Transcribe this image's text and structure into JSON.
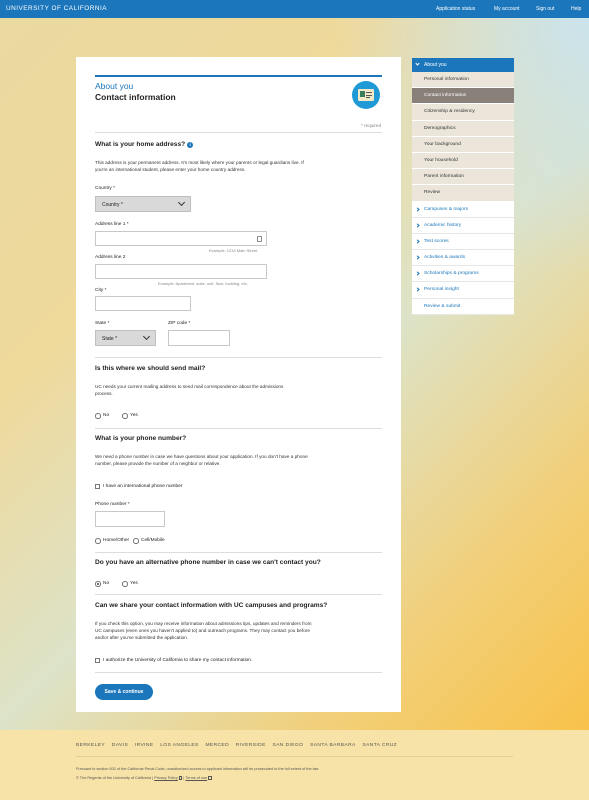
{
  "topbar": {
    "brand": "UNIVERSITY OF CALIFORNIA",
    "nav": [
      "Application status",
      "My account",
      "Sign out",
      "Help"
    ]
  },
  "header": {
    "section": "About you",
    "title": "Contact information",
    "required_note": "* required"
  },
  "home_address": {
    "question": "What is your home address?",
    "description": "This address is your permanent address. It's most likely where your parents or legal guardians live. If you're an international student, please enter your home country address.",
    "country_label": "Country *",
    "country_value": "Country *",
    "address1_label": "Address line 1 *",
    "address1_value": "",
    "address1_example": "Example: 1234 Main Street",
    "address2_label": "Address line 2",
    "address2_value": "",
    "address2_example": "Example: Apartment, suite, unit, floor, building, etc.",
    "city_label": "City *",
    "city_value": "",
    "state_label": "State *",
    "state_value": "State *",
    "zip_label": "ZIP code *",
    "zip_value": ""
  },
  "mailing": {
    "question": "Is this where we should send mail?",
    "description": "UC needs your current mailing address to send mail correspondence about the admissions process.",
    "options": [
      "No",
      "Yes"
    ],
    "selected": null
  },
  "phone": {
    "question": "What is your phone number?",
    "description": "We need a phone number in case we have questions about your application. If you don't have a phone number, please provide the number of a neighbor or relative.",
    "international_label": "I have an international phone number",
    "number_label": "Phone number *",
    "number_value": "",
    "type_options": [
      "Home/Other",
      "Cell/Mobile"
    ]
  },
  "alt_phone": {
    "question": "Do you have an alternative phone number in case we can't contact you?",
    "options": [
      "No",
      "Yes"
    ],
    "selected": "No"
  },
  "share": {
    "question": "Can we share your contact information with UC campuses and programs?",
    "description": "If you check this option, you may receive information about admissions tips, updates and reminders from UC campuses (even ones you haven't applied to) and outreach programs. They may contact you before and/or after you've submitted the application.",
    "authorize_label": "I authorize the University of California to share my contact information."
  },
  "save_button": "Save & continue",
  "sidebar": {
    "section": "About you",
    "sub_items": [
      "Personal information",
      "Contact information",
      "Citizenship & residency",
      "Demographics",
      "Your background",
      "Your household",
      "Parent information",
      "Review"
    ],
    "active_sub": "Contact information",
    "main_items": [
      "Campuses & majors",
      "Academic history",
      "Test scores",
      "Activities & awards",
      "Scholarships & programs",
      "Personal insight"
    ],
    "review_submit": "Review & submit"
  },
  "footer": {
    "campuses": [
      "BERKELEY",
      "DAVIS",
      "IRVINE",
      "LOS ANGELES",
      "MERCED",
      "RIVERSIDE",
      "SAN DIEGO",
      "SANTA BARBARA",
      "SANTA CRUZ"
    ],
    "legal": "Pursuant to section 502 of the California Penal Code, unauthorized access to applicant information will be prosecuted to the full extent of the law.",
    "copyright": "© The Regents of the University of California |",
    "privacy": "Privacy Policy",
    "sep": "|",
    "terms": "Terms of use"
  },
  "colors": {
    "brand_blue": "#1b76bb",
    "active_nav": "#8a807a",
    "sub_nav": "#ece6da"
  }
}
